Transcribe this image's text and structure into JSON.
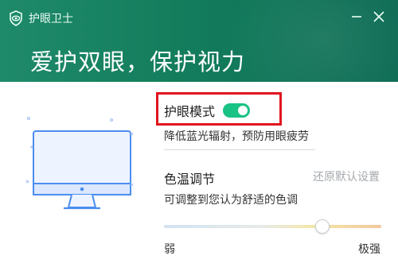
{
  "window": {
    "title": "护眼卫士",
    "headline": "爱护双眼，保护视力"
  },
  "eye_mode": {
    "label": "护眼模式",
    "enabled": true,
    "description": "降低蓝光辐射，预防用眼疲劳"
  },
  "color_temp": {
    "title": "色温调节",
    "reset_label": "还原默认设置",
    "description": "可调整到您认为舒适的色调",
    "slider_value_fraction": 0.73,
    "min_label": "弱",
    "max_label": "极强"
  },
  "colors": {
    "header_green": "#137d5c",
    "toggle_green": "#19c285",
    "highlight_red": "#e0151f",
    "monitor_blue": "#4b8df0"
  }
}
